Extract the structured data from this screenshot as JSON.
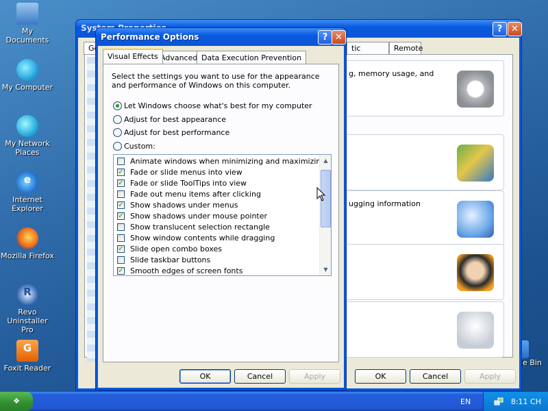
{
  "desktop": {
    "icons": [
      {
        "label_1": "My Documents",
        "label_2": "",
        "icon": "my-documents-icon"
      },
      {
        "label_1": "My Computer",
        "label_2": "",
        "icon": "my-computer-icon"
      },
      {
        "label_1": "My Network",
        "label_2": "Places",
        "icon": "network-places-icon"
      },
      {
        "label_1": "Internet",
        "label_2": "Explorer",
        "icon": "internet-explorer-icon"
      },
      {
        "label_1": "Mozilla Firefox",
        "label_2": "",
        "icon": "firefox-icon"
      },
      {
        "label_1": "Revo",
        "label_2": "Uninstaller Pro",
        "icon": "revo-uninstaller-icon"
      },
      {
        "label_1": "Foxit Reader",
        "label_2": "",
        "icon": "foxit-reader-icon"
      }
    ],
    "recycle_bin_fragment": "le Bin"
  },
  "system_properties": {
    "title": "System Properties",
    "tabs": {
      "general_fragment": "Ge",
      "automatic_updates_fragment": "tic Updates",
      "remote": "Remote"
    },
    "cards": [
      {
        "text": "g, memory usage, and"
      },
      {
        "text": ""
      },
      {
        "text": "ugging information"
      },
      {
        "text": ""
      },
      {
        "text": ""
      }
    ],
    "buttons": {
      "ok": "OK",
      "cancel": "Cancel",
      "apply": "Apply"
    },
    "help_glyph": "?",
    "close_glyph": "✕"
  },
  "performance_options": {
    "title": "Performance Options",
    "help_glyph": "?",
    "close_glyph": "✕",
    "tabs": {
      "visual_effects": "Visual Effects",
      "advanced": "Advanced",
      "dep": "Data Execution Prevention"
    },
    "intro": "Select the settings you want to use for the appearance and performance of Windows on this computer.",
    "radios": {
      "let_windows": "Let Windows choose what's best for my computer",
      "best_appearance": "Adjust for best appearance",
      "best_performance": "Adjust for best performance",
      "custom": "Custom:"
    },
    "selected_radio": "let_windows",
    "options": [
      {
        "label": "Animate windows when minimizing and maximizing",
        "checked": false
      },
      {
        "label": "Fade or slide menus into view",
        "checked": true
      },
      {
        "label": "Fade or slide ToolTips into view",
        "checked": true
      },
      {
        "label": "Fade out menu items after clicking",
        "checked": false
      },
      {
        "label": "Show shadows under menus",
        "checked": true
      },
      {
        "label": "Show shadows under mouse pointer",
        "checked": true
      },
      {
        "label": "Show translucent selection rectangle",
        "checked": false
      },
      {
        "label": "Show window contents while dragging",
        "checked": false
      },
      {
        "label": "Slide open combo boxes",
        "checked": true
      },
      {
        "label": "Slide taskbar buttons",
        "checked": false
      },
      {
        "label": "Smooth edges of screen fonts",
        "checked": true
      }
    ],
    "buttons": {
      "ok": "OK",
      "cancel": "Cancel",
      "apply": "Apply"
    }
  },
  "taskbar": {
    "language": "EN",
    "clock": "8:11 CH"
  },
  "colors": {
    "titlebar_blue": "#0a58d8",
    "dialog_face": "#ece9d8",
    "taskbar_blue": "#245edb",
    "check_green": "#21a121"
  }
}
